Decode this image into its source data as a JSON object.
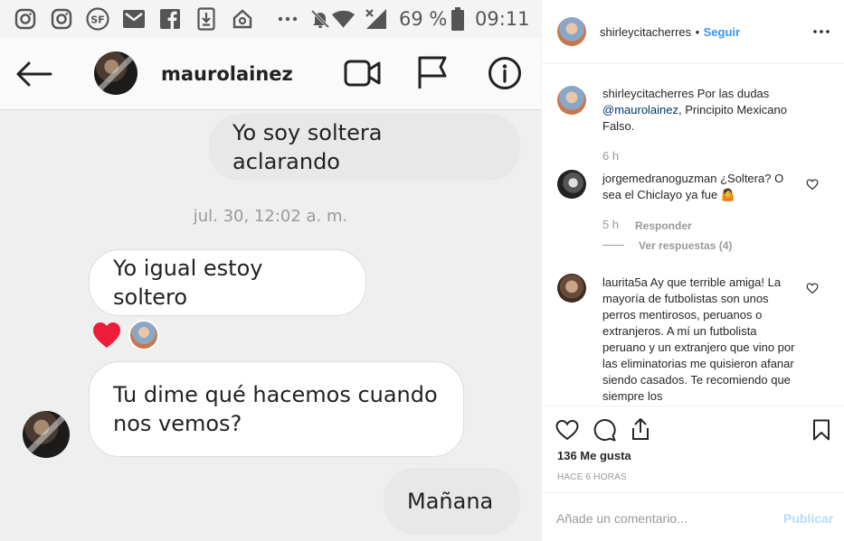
{
  "phone": {
    "status": {
      "battery_percent": "69 %",
      "time": "09:11",
      "icons": [
        "instagram-icon",
        "instagram-icon",
        "sf-icon",
        "gmail-icon",
        "facebook-icon",
        "download-icon",
        "home-icon",
        "more-dots-icon",
        "mute-icon",
        "wifi-icon",
        "no-signal-icon",
        "battery-icon"
      ]
    },
    "header": {
      "username": "maurolainez",
      "icons": [
        "back-arrow-icon",
        "video-call-icon",
        "flag-icon",
        "info-icon"
      ]
    },
    "messages": [
      {
        "direction": "out",
        "text": "Yo soy soltera aclarando"
      },
      {
        "direction": "in",
        "text": "Yo igual estoy soltero"
      },
      {
        "direction": "in",
        "text": "Tu dime qué hacemos cuando nos vemos?"
      },
      {
        "direction": "out",
        "text": "Mañana"
      }
    ],
    "timestamp": "jul. 30, 12:02 a. m.",
    "reaction": "heart"
  },
  "post": {
    "author": "shirleycitacherres",
    "follow_separator": "•",
    "follow_label": "Seguir",
    "caption": {
      "user": "shirleycitacherres",
      "text_before": "Por las dudas",
      "mention": "@maurolainez",
      "text_after": ", Principito Mexicano Falso.",
      "time": "6 h"
    },
    "comments": [
      {
        "user": "jorgemedranoguzman",
        "text": "¿Soltera? O sea el Chiclayo ya fue 🤷",
        "time": "5 h",
        "reply_label": "Responder",
        "replies_label": "Ver respuestas (4)"
      },
      {
        "user": "laurita5a",
        "text": "Ay que terrible amiga! La mayoría de futbolistas son unos perros mentirosos, peruanos o extranjeros. A mí un futbolista peruano y un extranjero que vino por las eliminatorias me quisieron afanar siendo casados. Te recomiendo que siempre los"
      }
    ],
    "likes": "136 Me gusta",
    "posted_ago": "HACE 6 HORAS",
    "comment_placeholder": "Añade un comentario...",
    "publish_label": "Publicar",
    "colors": {
      "link_blue": "#3897f0",
      "publish_disabled": "#b2dffc",
      "mention": "#003569"
    }
  }
}
